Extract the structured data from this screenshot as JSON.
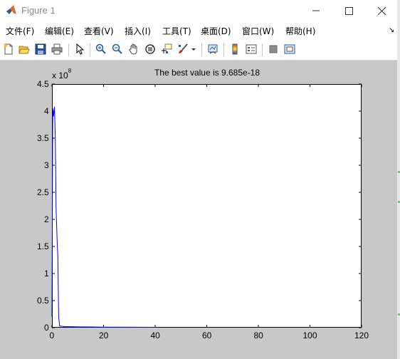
{
  "window": {
    "title": "Figure 1",
    "minimize_glyph": "minimize-icon",
    "maximize_glyph": "maximize-icon",
    "close_glyph": "close-icon"
  },
  "menu": {
    "items": [
      "文件(F)",
      "编辑(E)",
      "查看(V)",
      "插入(I)",
      "工具(T)",
      "桌面(D)",
      "窗口(W)",
      "帮助(H)"
    ],
    "dock_glyph": "↘"
  },
  "toolbar": {
    "icons": [
      "new-figure-icon",
      "open-file-icon",
      "save-icon",
      "print-icon",
      "pointer-icon",
      "zoom-in-icon",
      "zoom-out-icon",
      "pan-icon",
      "rotate-3d-icon",
      "data-cursor-icon",
      "brush-icon",
      "link-plot-icon",
      "colorbar-icon",
      "legend-icon",
      "hide-plot-tools-icon",
      "show-plot-tools-icon"
    ]
  },
  "chart_data": {
    "type": "line",
    "title": "The best value is 9.685e-18",
    "xlabel": "",
    "ylabel": "",
    "xlim": [
      0,
      120
    ],
    "ylim": [
      0,
      4.5
    ],
    "y_exponent_label": "x 10",
    "y_exponent": "8",
    "xticks": [
      0,
      20,
      40,
      60,
      80,
      100,
      120
    ],
    "xtick_labels": [
      "0",
      "20",
      "40",
      "60",
      "80",
      "100",
      "120"
    ],
    "yticks": [
      0,
      0.5,
      1,
      1.5,
      2,
      2.5,
      3,
      3.5,
      4,
      4.5
    ],
    "ytick_labels": [
      "0",
      "0.5",
      "1",
      "1.5",
      "2",
      "2.5",
      "3",
      "3.5",
      "4",
      "4.5"
    ],
    "grid": false,
    "series": [
      {
        "color": "#0000ff",
        "x": [
          0,
          0.3,
          0.6,
          1,
          1.3,
          1.6,
          2,
          2.3,
          2.6,
          3,
          5,
          10,
          20,
          30,
          40,
          41
        ],
        "y": [
          0.2,
          4.05,
          3.9,
          4.08,
          3.5,
          2.2,
          1.6,
          1.3,
          0.2,
          0.03,
          0.02,
          0.015,
          0.01,
          0.008,
          0.006,
          0.006
        ]
      }
    ]
  }
}
